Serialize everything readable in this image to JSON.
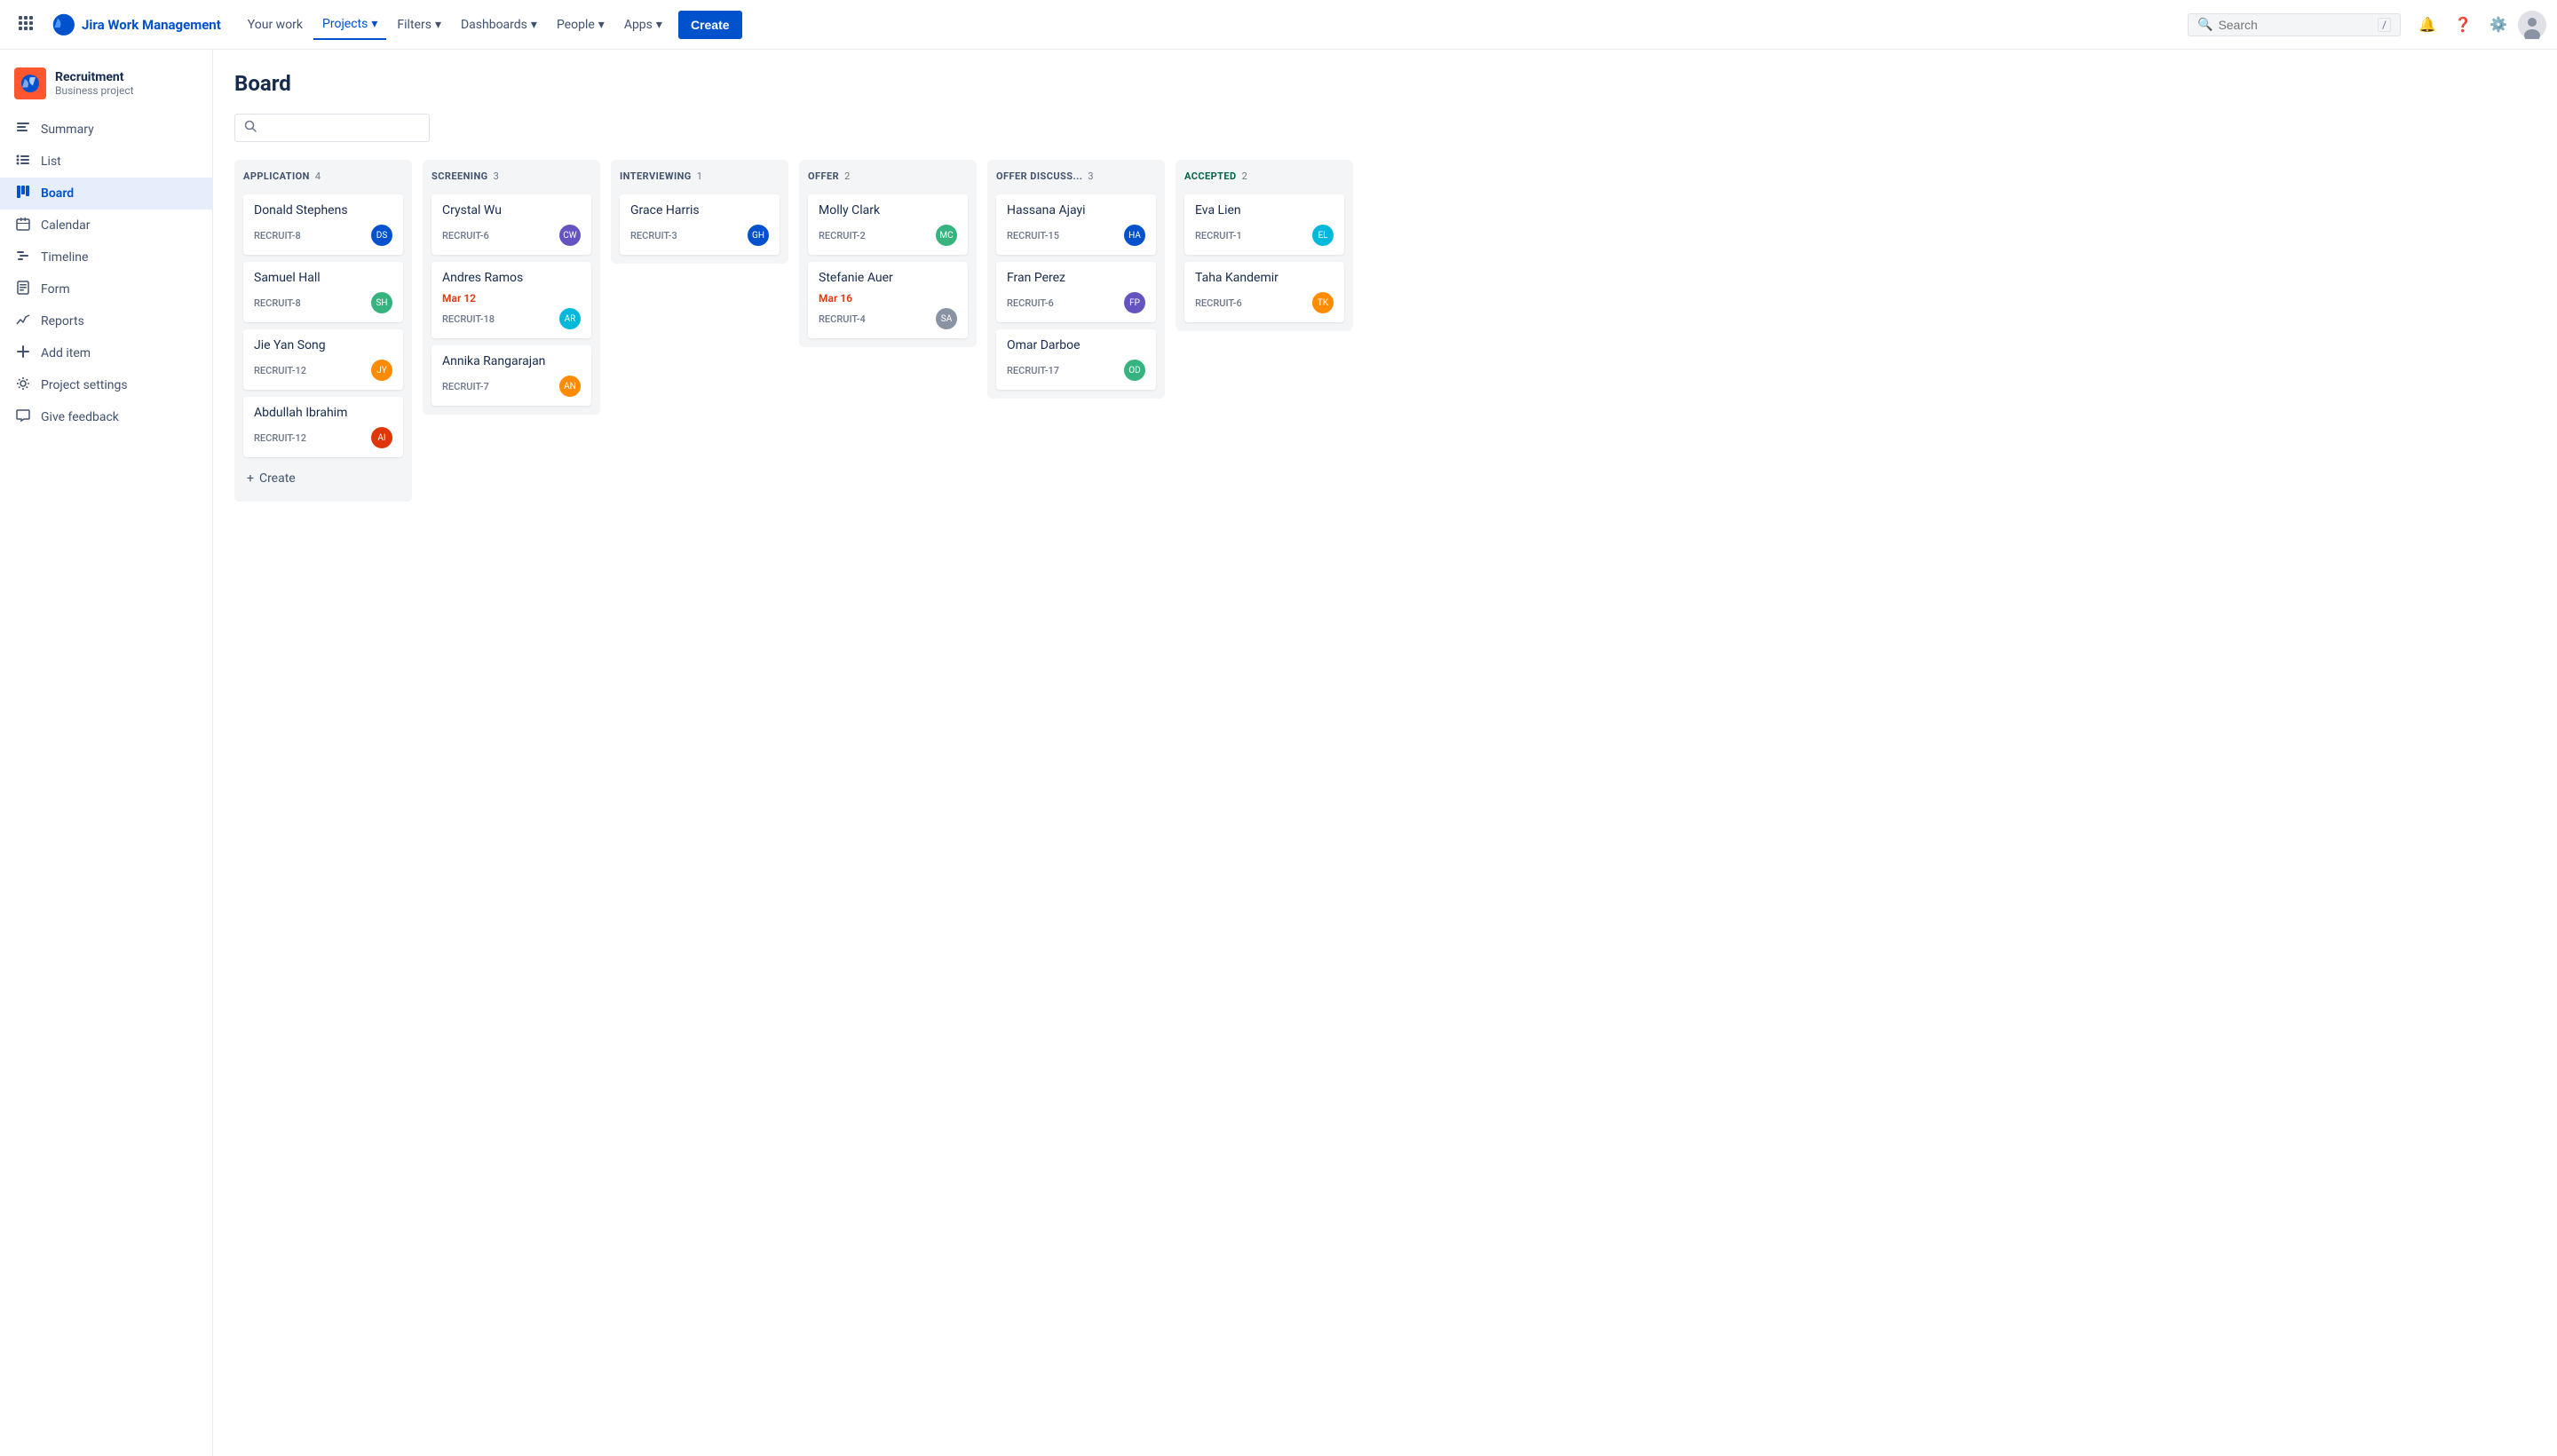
{
  "topnav": {
    "logo_text": "Jira Work Management",
    "nav_items": [
      {
        "label": "Your work",
        "active": false
      },
      {
        "label": "Projects",
        "active": true
      },
      {
        "label": "Filters",
        "active": false
      },
      {
        "label": "Dashboards",
        "active": false
      },
      {
        "label": "People",
        "active": false
      },
      {
        "label": "Apps",
        "active": false
      }
    ],
    "create_label": "Create",
    "search_placeholder": "Search",
    "search_shortcut": "/"
  },
  "sidebar": {
    "project_name": "Recruitment",
    "project_type": "Business project",
    "items": [
      {
        "id": "summary",
        "label": "Summary",
        "icon": "≡"
      },
      {
        "id": "list",
        "label": "List",
        "icon": "☰"
      },
      {
        "id": "board",
        "label": "Board",
        "icon": "⊞",
        "active": true
      },
      {
        "id": "calendar",
        "label": "Calendar",
        "icon": "📅"
      },
      {
        "id": "timeline",
        "label": "Timeline",
        "icon": "≋"
      },
      {
        "id": "form",
        "label": "Form",
        "icon": "⬜"
      },
      {
        "id": "reports",
        "label": "Reports",
        "icon": "📊"
      },
      {
        "id": "add-item",
        "label": "Add item",
        "icon": "+"
      },
      {
        "id": "project-settings",
        "label": "Project settings",
        "icon": "⚙"
      },
      {
        "id": "give-feedback",
        "label": "Give feedback",
        "icon": "💬"
      }
    ]
  },
  "board": {
    "title": "Board",
    "search_placeholder": "",
    "columns": [
      {
        "id": "application",
        "title": "APPLICATION",
        "count": 4,
        "color": "default",
        "cards": [
          {
            "name": "Donald Stephens",
            "id": "RECRUIT-8",
            "avatar_initials": "DS",
            "avatar_color": "av-blue"
          },
          {
            "name": "Samuel Hall",
            "id": "RECRUIT-8",
            "avatar_initials": "SH",
            "avatar_color": "av-green"
          },
          {
            "name": "Jie Yan Song",
            "id": "RECRUIT-12",
            "avatar_initials": "JY",
            "avatar_color": "av-orange"
          },
          {
            "name": "Abdullah Ibrahim",
            "id": "RECRUIT-12",
            "avatar_initials": "AI",
            "avatar_color": "av-red"
          }
        ],
        "has_create": true
      },
      {
        "id": "screening",
        "title": "SCREENING",
        "count": 3,
        "color": "default",
        "cards": [
          {
            "name": "Crystal Wu",
            "id": "RECRUIT-6",
            "avatar_initials": "CW",
            "avatar_color": "av-purple"
          },
          {
            "name": "Andres Ramos",
            "id": "RECRUIT-18",
            "due_date": "Mar 12",
            "avatar_initials": "AR",
            "avatar_color": "av-teal"
          },
          {
            "name": "Annika Rangarajan",
            "id": "RECRUIT-7",
            "avatar_initials": "AN",
            "avatar_color": "av-orange"
          }
        ]
      },
      {
        "id": "interviewing",
        "title": "INTERVIEWING",
        "count": 1,
        "color": "default",
        "cards": [
          {
            "name": "Grace Harris",
            "id": "RECRUIT-3",
            "avatar_initials": "GH",
            "avatar_color": "av-blue"
          }
        ]
      },
      {
        "id": "offer",
        "title": "OFFER",
        "count": 2,
        "color": "default",
        "cards": [
          {
            "name": "Molly Clark",
            "id": "RECRUIT-2",
            "avatar_initials": "MC",
            "avatar_color": "av-green"
          },
          {
            "name": "Stefanie Auer",
            "id": "RECRUIT-4",
            "due_date": "Mar 16",
            "avatar_initials": "SA",
            "avatar_color": "av-gray"
          }
        ]
      },
      {
        "id": "offer-discuss",
        "title": "OFFER DISCUSS...",
        "count": 3,
        "color": "default",
        "cards": [
          {
            "name": "Hassana Ajayi",
            "id": "RECRUIT-15",
            "avatar_initials": "HA",
            "avatar_color": "av-blue"
          },
          {
            "name": "Fran Perez",
            "id": "RECRUIT-6",
            "avatar_initials": "FP",
            "avatar_color": "av-purple"
          },
          {
            "name": "Omar Darboe",
            "id": "RECRUIT-17",
            "avatar_initials": "OD",
            "avatar_color": "av-green"
          }
        ]
      },
      {
        "id": "accepted",
        "title": "ACCEPTED",
        "count": 2,
        "color": "accepted",
        "cards": [
          {
            "name": "Eva Lien",
            "id": "RECRUIT-1",
            "avatar_initials": "EL",
            "avatar_color": "av-teal"
          },
          {
            "name": "Taha Kandemir",
            "id": "RECRUIT-6",
            "avatar_initials": "TK",
            "avatar_color": "av-orange"
          }
        ]
      }
    ],
    "create_label": "Create"
  }
}
